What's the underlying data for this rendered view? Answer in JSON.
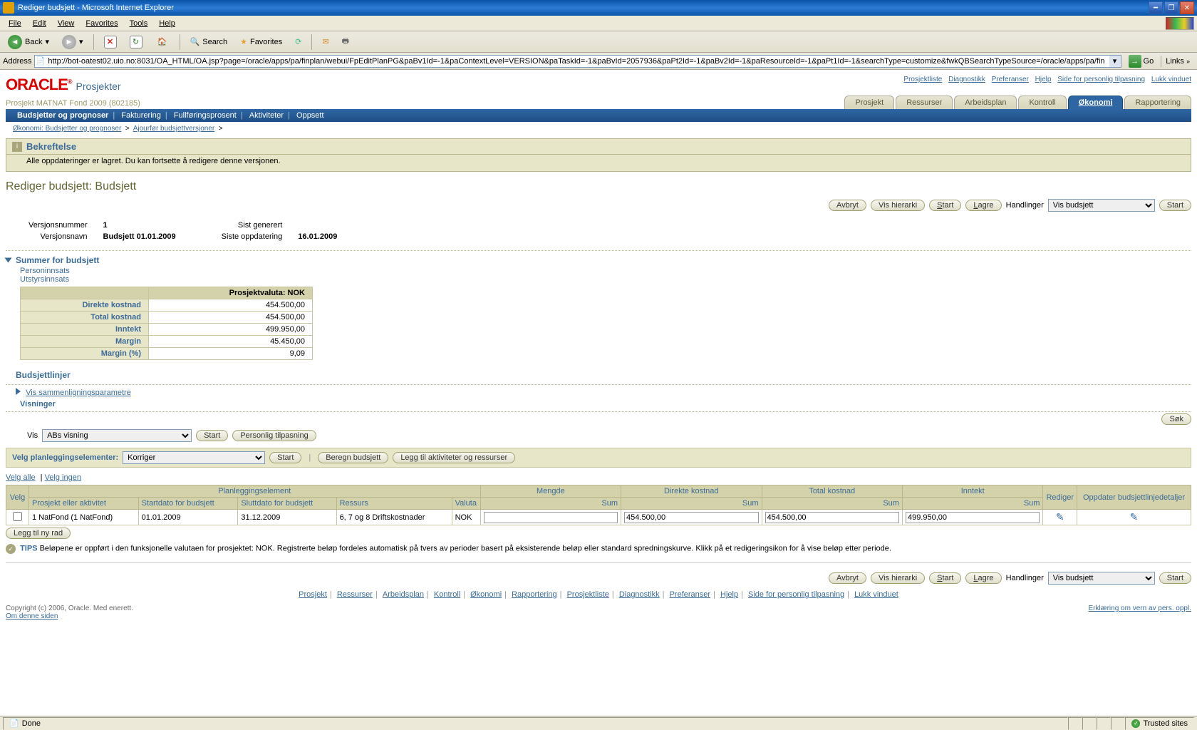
{
  "ie": {
    "title": "Rediger budsjett - Microsoft Internet Explorer",
    "menus": [
      "File",
      "Edit",
      "View",
      "Favorites",
      "Tools",
      "Help"
    ],
    "back": "Back",
    "search": "Search",
    "favorites": "Favorites",
    "addr_label": "Address",
    "url": "http://bot-oatest02.uio.no:8031/OA_HTML/OA.jsp?page=/oracle/apps/pa/finplan/webui/FpEditPlanPG&paBv1Id=-1&paContextLevel=VERSION&paTaskId=-1&paBvId=2057936&paPt2Id=-1&paBv2Id=-1&paResourceId=-1&paPt1Id=-1&searchType=customize&fwkQBSearchTypeSource=/oracle/apps/pa/fin",
    "go": "Go",
    "links": "Links",
    "status": "Done",
    "trusted": "Trusted sites"
  },
  "header": {
    "logo": "ORACLE",
    "app": "Prosjekter",
    "links": [
      "Prosjektliste",
      "Diagnostikk",
      "Preferanser",
      "Hjelp",
      "Side for personlig tilpasning",
      "Lukk vinduet"
    ],
    "project": "Prosjekt MATNAT Fond 2009 (802185)",
    "tabs": [
      "Prosjekt",
      "Ressurser",
      "Arbeidsplan",
      "Kontroll",
      "Økonomi",
      "Rapportering"
    ],
    "active_tab": "Økonomi"
  },
  "subnav": {
    "items": [
      "Budsjetter og prognoser",
      "Fakturering",
      "Fullføringsprosent",
      "Aktiviteter",
      "Oppsett"
    ],
    "active": "Budsjetter og prognoser"
  },
  "breadcrumb": {
    "a": "Økonomi: Budsjetter og prognoser",
    "b": "Ajourfør budsjettversjoner"
  },
  "confirm": {
    "title": "Bekreftelse",
    "msg": "Alle oppdateringer er lagret. Du kan fortsette å redigere denne versjonen."
  },
  "page_title": "Rediger budsjett: Budsjett",
  "actions": {
    "avbryt": "Avbryt",
    "vis_hierarki": "Vis hierarki",
    "start": "Start",
    "lagre": "Lagre",
    "handlinger": "Handlinger",
    "dropdown": "Vis budsjett"
  },
  "version": {
    "num_lbl": "Versjonsnummer",
    "num": "1",
    "name_lbl": "Versjonsnavn",
    "name": "Budsjett 01.01.2009",
    "gen_lbl": "Sist generert",
    "gen": "",
    "upd_lbl": "Siste oppdatering",
    "upd": "16.01.2009"
  },
  "summary": {
    "heading": "Summer for budsjett",
    "personinnsats": "Personinnsats",
    "utstyrsinnsats": "Utstyrsinnsats",
    "currency_hdr": "Prosjektvaluta: NOK",
    "rows": {
      "direkte": {
        "lbl": "Direkte kostnad",
        "val": "454.500,00"
      },
      "total": {
        "lbl": "Total kostnad",
        "val": "454.500,00"
      },
      "inntekt": {
        "lbl": "Inntekt",
        "val": "499.950,00"
      },
      "margin": {
        "lbl": "Margin",
        "val": "45.450,00"
      },
      "margin_pct": {
        "lbl": "Margin (%)",
        "val": "9,09"
      }
    }
  },
  "lines": {
    "heading": "Budsjettlinjer",
    "compare": "Vis sammenligningsparametre",
    "visninger": "Visninger",
    "vis_lbl": "Vis",
    "vis_val": "ABs visning",
    "personlig": "Personlig tilpasning",
    "velg_label": "Velg planleggingselementer:",
    "velg_val": "Korriger",
    "beregn": "Beregn budsjett",
    "legg_akt": "Legg til aktiviteter og ressurser",
    "velg_alle": "Velg alle",
    "velg_ingen": "Velg ingen",
    "sok": "Søk",
    "legg_rad": "Legg til ny rad"
  },
  "grid": {
    "groups": {
      "planlegging": "Planleggingselement",
      "mengde": "Mengde",
      "direkte": "Direkte kostnad",
      "total": "Total kostnad",
      "inntekt": "Inntekt"
    },
    "cols": {
      "velg": "Velg",
      "prosjekt": "Prosjekt eller aktivitet",
      "start": "Startdato for budsjett",
      "slutt": "Sluttdato for budsjett",
      "ressurs": "Ressurs",
      "valuta": "Valuta",
      "sum": "Sum",
      "rediger": "Rediger",
      "oppdater": "Oppdater budsjettlinjedetaljer"
    },
    "row": {
      "prosjekt": "1 NatFond (1 NatFond)",
      "start": "01.01.2009",
      "slutt": "31.12.2009",
      "ressurs": "6, 7 og 8 Driftskostnader",
      "valuta": "NOK",
      "mengde": "",
      "direkte": "454.500,00",
      "total": "454.500,00",
      "inntekt": "499.950,00"
    }
  },
  "tips": {
    "label": "TIPS",
    "text": "Beløpene er oppført i den funksjonelle valutaen for prosjektet: NOK. Registrerte beløp fordeles automatisk på tvers av perioder basert på eksisterende beløp eller standard spredningskurve. Klikk på et redigeringsikon for å vise beløp etter periode."
  },
  "footer": {
    "links": [
      "Prosjekt",
      "Ressurser",
      "Arbeidsplan",
      "Kontroll",
      "Økonomi",
      "Rapportering",
      "Prosjektliste",
      "Diagnostikk",
      "Preferanser",
      "Hjelp",
      "Side for personlig tilpasning",
      "Lukk vinduet"
    ],
    "copyright": "Copyright (c) 2006, Oracle. Med enerett.",
    "about": "Om denne siden",
    "privacy": "Erklæring om vern av pers. oppl."
  }
}
